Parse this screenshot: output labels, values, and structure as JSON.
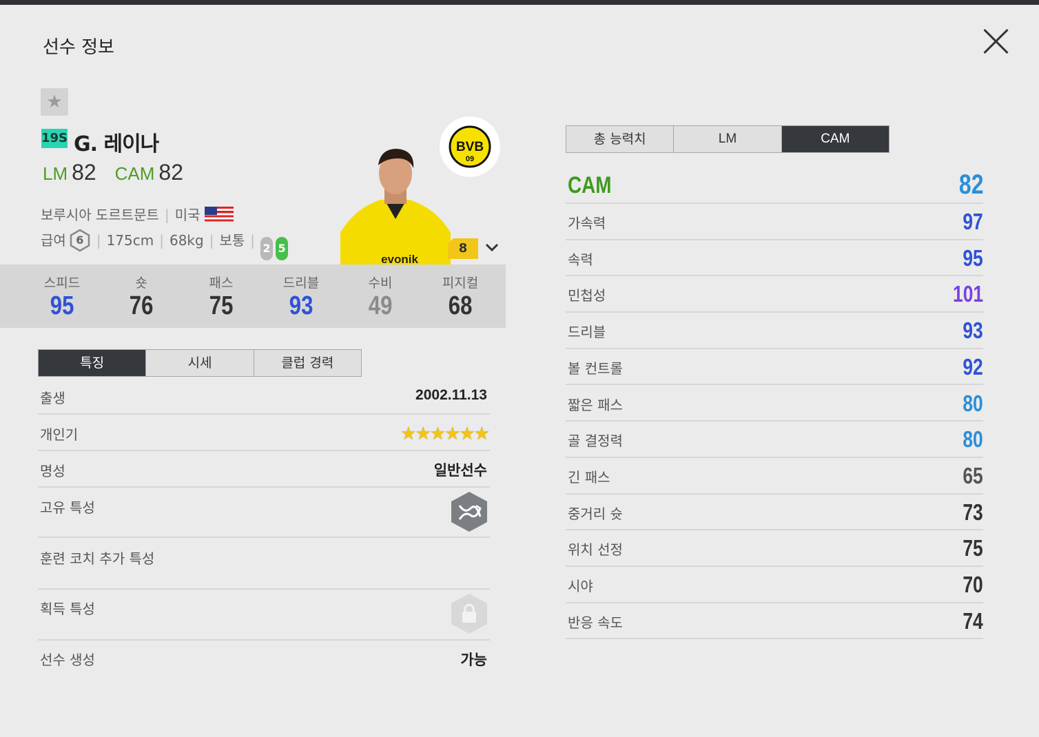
{
  "modal": {
    "title": "선수 정보"
  },
  "player": {
    "season": "19S",
    "name": "G. 레이나",
    "positions": [
      {
        "pos": "LM",
        "ovr": "82"
      },
      {
        "pos": "CAM",
        "ovr": "82"
      }
    ],
    "club": "보루시아 도르트문트",
    "nation": "미국",
    "pay_label": "급여",
    "pay": "6",
    "height": "175cm",
    "weight": "68kg",
    "body": "보통",
    "weak_foot": "2",
    "strong_foot": "5",
    "grade": "8",
    "club_logo_text": "BVB",
    "club_logo_year": "09",
    "shirt_sponsor": "evonik"
  },
  "summary_stats": [
    {
      "label": "스피드",
      "value": "95",
      "color": "#2f52d6"
    },
    {
      "label": "숏",
      "value": "76",
      "color": "#333333"
    },
    {
      "label": "패스",
      "value": "75",
      "color": "#333333"
    },
    {
      "label": "드리블",
      "value": "93",
      "color": "#2f52d6"
    },
    {
      "label": "수비",
      "value": "49",
      "color": "#8b8b8b"
    },
    {
      "label": "피지컬",
      "value": "68",
      "color": "#333333"
    }
  ],
  "left_tabs": [
    "특징",
    "시세",
    "클럽 경력"
  ],
  "info": {
    "birth_label": "출생",
    "birth": "2002.11.13",
    "skill_label": "개인기",
    "skill_stars": 6,
    "fame_label": "명성",
    "fame": "일반선수",
    "unique_label": "고유 특성",
    "coach_label": "훈련 코치 추가 특성",
    "acquired_label": "획득 특성",
    "create_label": "선수 생성",
    "create": "가능"
  },
  "right_tabs": [
    "총 능력치",
    "LM",
    "CAM"
  ],
  "detail_head": {
    "label": "CAM",
    "value": "82",
    "color": "#2a8fd8"
  },
  "details": [
    {
      "label": "가속력",
      "value": "97",
      "color": "#2f52d6"
    },
    {
      "label": "속력",
      "value": "95",
      "color": "#2f52d6"
    },
    {
      "label": "민첩성",
      "value": "101",
      "color": "#7b3fe0"
    },
    {
      "label": "드리블",
      "value": "93",
      "color": "#2f52d6"
    },
    {
      "label": "볼 컨트롤",
      "value": "92",
      "color": "#2f52d6"
    },
    {
      "label": "짧은 패스",
      "value": "80",
      "color": "#2a8fd8"
    },
    {
      "label": "골 결정력",
      "value": "80",
      "color": "#2a8fd8"
    },
    {
      "label": "긴 패스",
      "value": "65",
      "color": "#555555"
    },
    {
      "label": "중거리 슛",
      "value": "73",
      "color": "#333333"
    },
    {
      "label": "위치 선정",
      "value": "75",
      "color": "#333333"
    },
    {
      "label": "시야",
      "value": "70",
      "color": "#333333"
    },
    {
      "label": "반응 속도",
      "value": "74",
      "color": "#333333"
    }
  ]
}
